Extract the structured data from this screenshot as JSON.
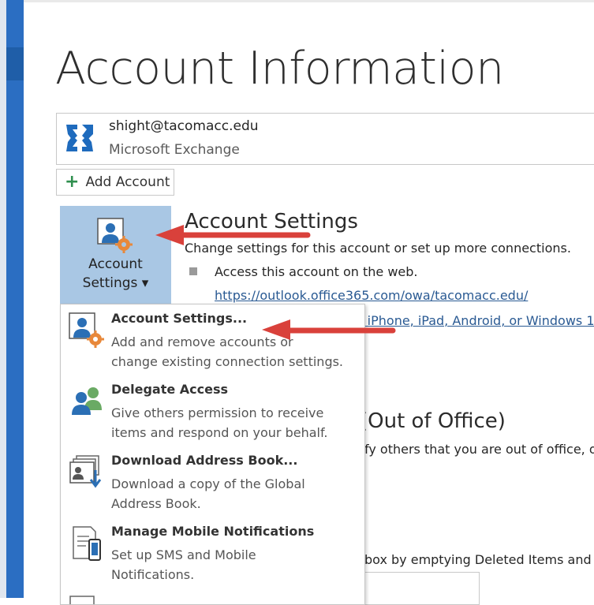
{
  "page": {
    "title": "Account Information"
  },
  "account": {
    "email": "shight@tacomacc.edu",
    "type": "Microsoft Exchange",
    "icon": "exchange-icon"
  },
  "add_account": {
    "label": "Add Account",
    "icon": "plus-icon"
  },
  "account_settings_button": {
    "line1": "Account",
    "line2": "Settings ▾",
    "icon": "account-settings-icon"
  },
  "account_settings_section": {
    "title": "Account Settings",
    "description": "Change settings for this account or set up more connections.",
    "web_access_text": "Access this account on the web.",
    "web_link": "https://outlook.office365.com/owa/tacomacc.edu/",
    "mobile_link_partial": "r iPhone, iPad, Android, or Windows 1"
  },
  "out_of_office": {
    "title_partial": "(Out of Office)",
    "description_partial": "fy others that you are out of office, o"
  },
  "cleanup": {
    "description_partial": "box by emptying Deleted Items and"
  },
  "dropdown_menu": {
    "items": [
      {
        "title": "Account Settings...",
        "desc1": "Add and remove accounts or",
        "desc2": "change existing connection settings.",
        "icon": "account-settings-icon"
      },
      {
        "title": "Delegate Access",
        "desc1": "Give others permission to receive",
        "desc2": "items and respond on your behalf.",
        "icon": "delegate-people-icon"
      },
      {
        "title": "Download Address Book...",
        "desc1": "Download a copy of the Global",
        "desc2": "Address Book.",
        "icon": "address-book-download-icon"
      },
      {
        "title": "Manage Mobile Notifications",
        "desc1": "Set up SMS and Mobile",
        "desc2": "Notifications.",
        "icon": "mobile-notifications-icon"
      }
    ]
  },
  "colors": {
    "nav_blue": "#2b6ec2",
    "selected_button": "#a9c7e4",
    "link": "#2a5a93",
    "arrow_red": "#d9413b",
    "add_green": "#2f8f4e"
  }
}
